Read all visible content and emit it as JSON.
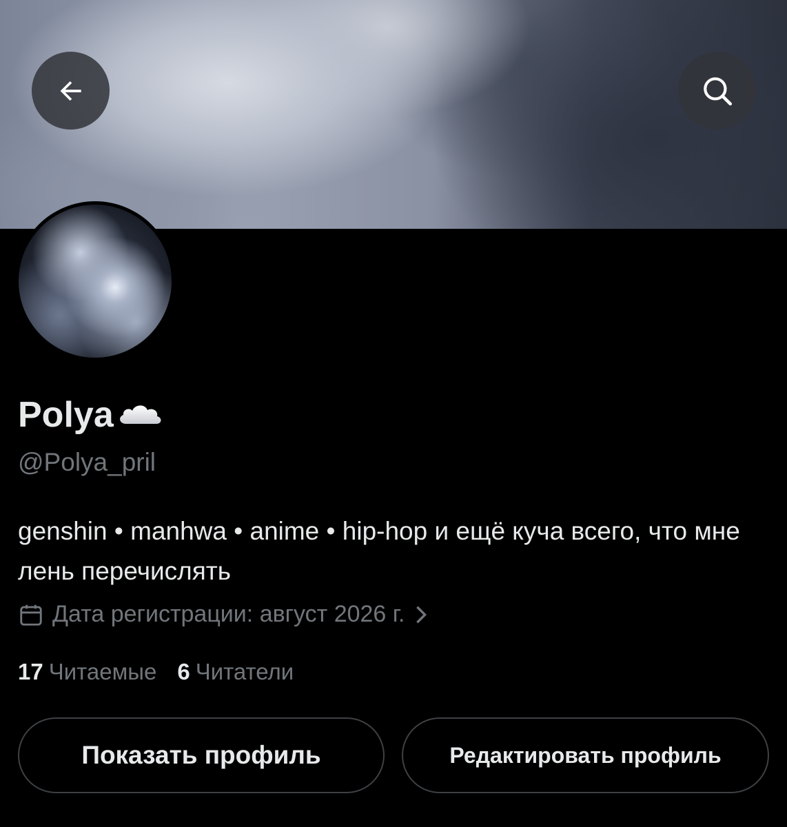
{
  "profile": {
    "display_name": "Polya",
    "name_emoji_icon": "cloud-icon",
    "handle": "@Polya_pril",
    "bio": "genshin • manhwa • anime • hip-hop и ещё куча всего, что мне лень перечислять",
    "joined": "Дата регистрации: август 2026 г.",
    "following_count": "17",
    "following_label": "Читаемые",
    "followers_count": "6",
    "followers_label": "Читатели"
  },
  "header": {
    "back_icon": "arrow-left-icon",
    "search_icon": "search-icon"
  },
  "buttons": {
    "show_profile": "Показать профиль",
    "edit_profile": "Редактировать профиль"
  },
  "colors": {
    "background": "#000000",
    "primary_text": "#e7e9ea",
    "secondary_text": "#71767b",
    "button_border": "#3e4144"
  }
}
